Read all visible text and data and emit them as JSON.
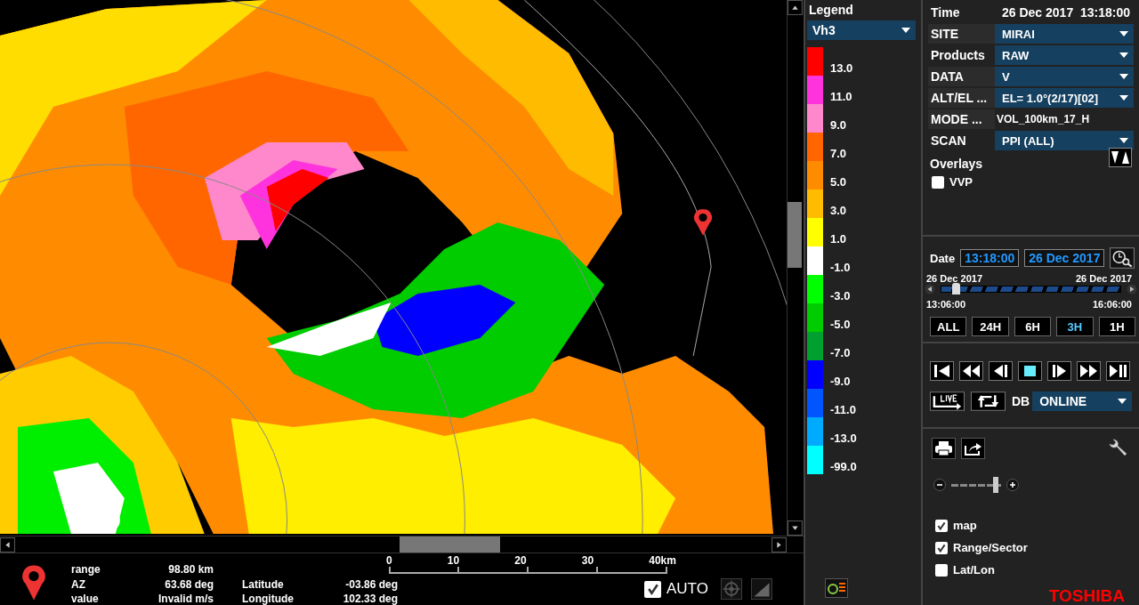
{
  "info": {
    "rows": [
      {
        "label": "range",
        "value": "98.80 km"
      },
      {
        "label": "AZ",
        "value": "63.68 deg"
      },
      {
        "label": "value",
        "value": "Invalid m/s"
      }
    ],
    "coords": [
      {
        "label": "Latitude",
        "value": "-03.86 deg"
      },
      {
        "label": "Longitude",
        "value": "102.33 deg"
      }
    ]
  },
  "scale": {
    "ticks": [
      "0",
      "10",
      "20",
      "30",
      "40km"
    ]
  },
  "auto": {
    "label": "AUTO",
    "checked": true
  },
  "legend": {
    "title": "Legend",
    "palette": "Vh3",
    "bins": [
      {
        "color": "#ff0000",
        "label": "13.0"
      },
      {
        "color": "#ff33dd",
        "label": "11.0"
      },
      {
        "color": "#ff88cc",
        "label": "9.0"
      },
      {
        "color": "#ff6600",
        "label": "7.0"
      },
      {
        "color": "#ff8c00",
        "label": "5.0"
      },
      {
        "color": "#ffbb00",
        "label": "3.0"
      },
      {
        "color": "#ffff00",
        "label": "1.0"
      },
      {
        "color": "#ffffff",
        "label": "-1.0"
      },
      {
        "color": "#00ff00",
        "label": "-3.0"
      },
      {
        "color": "#00cc00",
        "label": "-5.0"
      },
      {
        "color": "#00a030",
        "label": "-7.0"
      },
      {
        "color": "#0000ff",
        "label": "-9.0"
      },
      {
        "color": "#0055ff",
        "label": "-11.0"
      },
      {
        "color": "#00aaff",
        "label": "-13.0"
      },
      {
        "color": "#00ffff",
        "label": "-99.0"
      }
    ]
  },
  "time": {
    "label": "Time",
    "value": "26 Dec 2017  13:18:00"
  },
  "fields": [
    {
      "label": "SITE",
      "value": "MIRAI",
      "kind": "dropdown"
    },
    {
      "label": "Products",
      "value": "RAW",
      "kind": "dropdown"
    },
    {
      "label": "DATA",
      "value": "V",
      "kind": "dropdown"
    },
    {
      "label": "ALT/EL  ...",
      "value": "EL=   1.0°(2/17)[02]",
      "kind": "dropdown"
    },
    {
      "label": "MODE    ...",
      "value": "VOL_100km_17_H",
      "kind": "text"
    },
    {
      "label": "SCAN",
      "value": "PPI (ALL)",
      "kind": "dropdown"
    }
  ],
  "overlays": {
    "title": "Overlays",
    "items": [
      {
        "label": "VVP",
        "checked": false
      }
    ]
  },
  "timeline": {
    "label": "Date",
    "time": "13:18:00",
    "date": "26 Dec 2017",
    "start_date": "26 Dec 2017",
    "end_date": "26 Dec 2017",
    "start_time": "13:06:00",
    "end_time": "16:06:00",
    "level": 0.06
  },
  "ranges": [
    {
      "label": "ALL",
      "selected": false
    },
    {
      "label": "24H",
      "selected": false
    },
    {
      "label": "6H",
      "selected": false
    },
    {
      "label": "3H",
      "selected": true
    },
    {
      "label": "1H",
      "selected": false
    }
  ],
  "db": {
    "label": "DB",
    "value": "ONLINE"
  },
  "zoom": {
    "level": 0.95
  },
  "layers": [
    {
      "label": "map",
      "checked": true
    },
    {
      "label": "Range/Sector",
      "checked": true
    },
    {
      "label": "Lat/Lon",
      "checked": false
    }
  ],
  "brand": "TOSHIBA"
}
